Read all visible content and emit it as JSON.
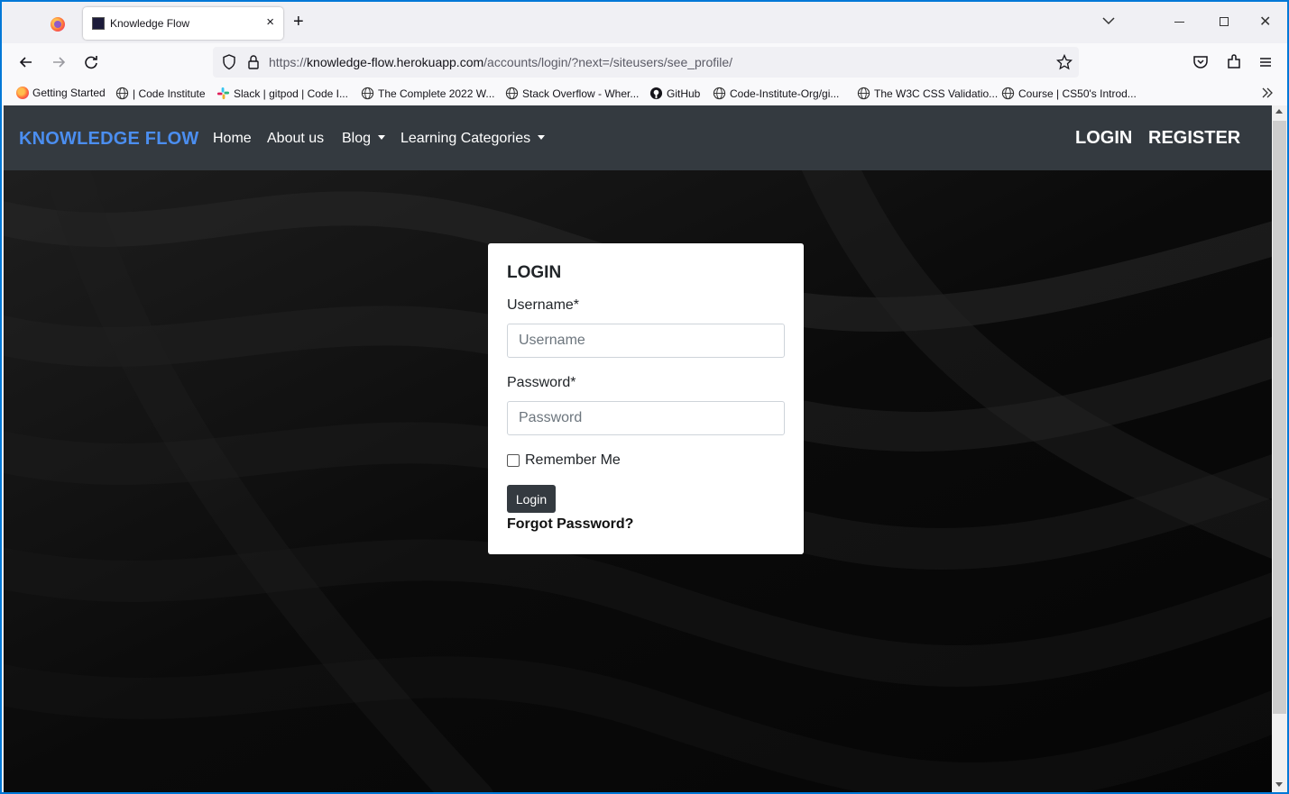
{
  "browser": {
    "tab_title": "Knowledge Flow",
    "new_tab_symbol": "+",
    "tab_close_symbol": "×",
    "window_close_symbol": "✕",
    "url_prefix": "https://",
    "url_host": "knowledge-flow.herokuapp.com",
    "url_path": "/accounts/login/?next=/siteusers/see_profile/"
  },
  "bookmarks": [
    {
      "label": "Getting Started",
      "icon": "firefox-icon"
    },
    {
      "label": "| Code Institute",
      "icon": "globe-icon"
    },
    {
      "label": "Slack | gitpod | Code I...",
      "icon": "slack-icon"
    },
    {
      "label": "The Complete 2022 W...",
      "icon": "globe-icon"
    },
    {
      "label": "Stack Overflow - Wher...",
      "icon": "globe-icon"
    },
    {
      "label": "GitHub",
      "icon": "github-icon"
    },
    {
      "label": "Code-Institute-Org/gi...",
      "icon": "globe-icon"
    },
    {
      "label": "The W3C CSS Validatio...",
      "icon": "globe-icon"
    },
    {
      "label": "Course | CS50's Introd...",
      "icon": "globe-icon"
    }
  ],
  "site_nav": {
    "brand": "KNOWLEDGE FLOW",
    "links": [
      "Home",
      "About us",
      "Blog",
      "Learning Categories"
    ],
    "login": "LOGIN",
    "register": "REGISTER"
  },
  "login_form": {
    "title": "LOGIN",
    "username_label": "Username*",
    "username_placeholder": "Username",
    "password_label": "Password*",
    "password_placeholder": "Password",
    "remember_label": "Remember Me",
    "submit_label": "Login",
    "forgot_link": "Forgot Password?"
  },
  "colors": {
    "brand": "#4b8ef0",
    "navbar_bg": "#343a40",
    "page_bg": "#000000",
    "window_border": "#0078d7"
  }
}
